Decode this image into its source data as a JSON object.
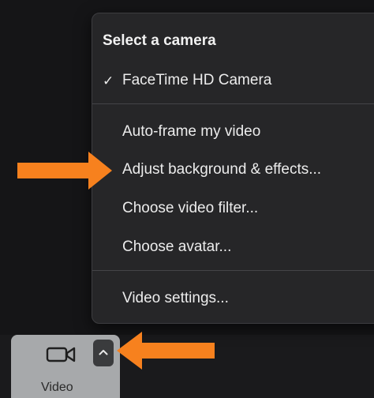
{
  "menu": {
    "header": "Select a camera",
    "selected_camera_check": "✓",
    "selected_camera": "FaceTime HD Camera",
    "items": [
      {
        "label": "Auto-frame my video"
      },
      {
        "label": "Adjust background & effects..."
      },
      {
        "label": "Choose video filter..."
      },
      {
        "label": "Choose avatar..."
      }
    ],
    "settings_label": "Video settings..."
  },
  "toolbar": {
    "video_label": "Video",
    "video_icon": "video-camera-icon",
    "caret_icon": "chevron-up-icon"
  },
  "annotations": {
    "arrow_color": "#f7811e"
  },
  "colors": {
    "menu_bg": "#262628",
    "toolbar_bg": "#a7a9ab",
    "caret_bg": "#3a3b3d"
  }
}
